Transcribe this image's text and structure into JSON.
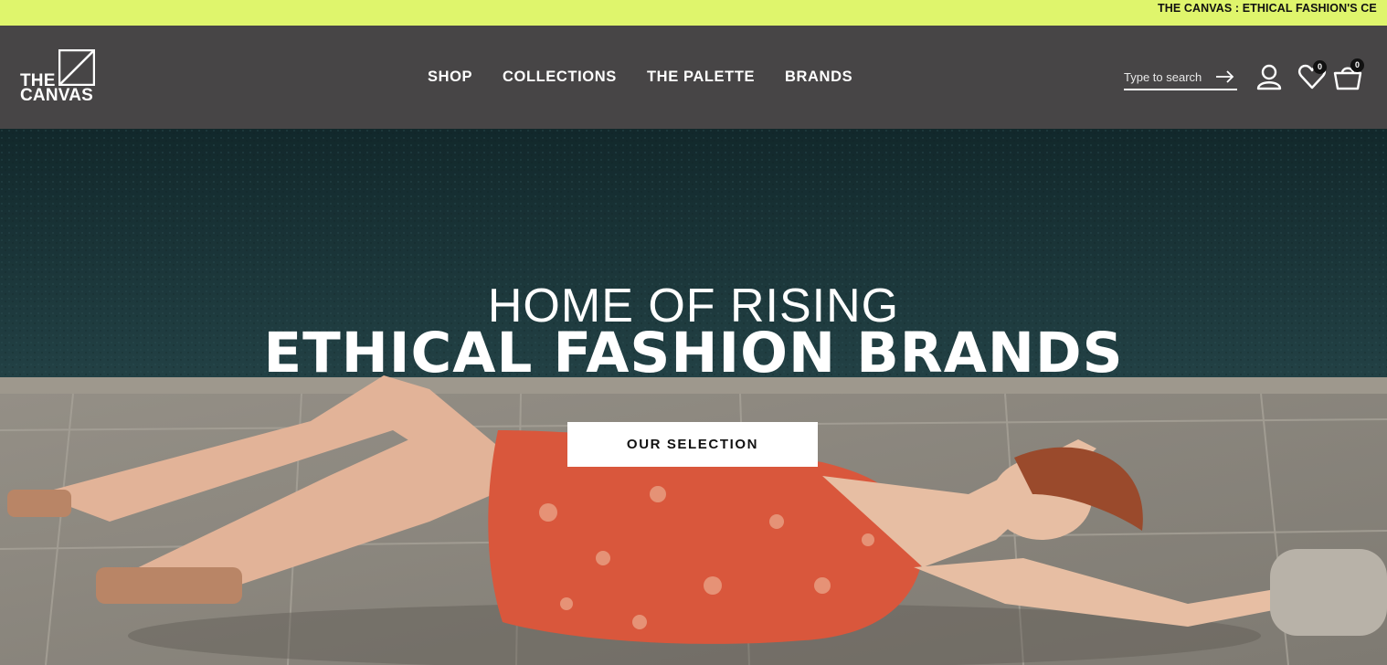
{
  "announcement": {
    "text": "THE CANVAS : ETHICAL FASHION'S CE"
  },
  "logo": {
    "line1": "THE",
    "line2": "CANVAS"
  },
  "nav": {
    "items": [
      {
        "label": "SHOP"
      },
      {
        "label": "COLLECTIONS"
      },
      {
        "label": "THE PALETTE"
      },
      {
        "label": "BRANDS"
      }
    ]
  },
  "search": {
    "placeholder": "Type to search"
  },
  "header_icons": {
    "account": "user-icon",
    "wishlist": "heart-icon",
    "cart": "shopping-bag-icon",
    "wishlist_count": "0",
    "cart_count": "0"
  },
  "hero": {
    "line1": "HOME OF RISING",
    "line2": "ETHICAL FASHION BRANDS",
    "cta_label": "OUR SELECTION"
  },
  "colors": {
    "announcement_bg": "#dff56c",
    "header_bg": "#474546",
    "pool": "#1c3a3d",
    "stone": "#8d887f",
    "dress": "#d9573c"
  }
}
